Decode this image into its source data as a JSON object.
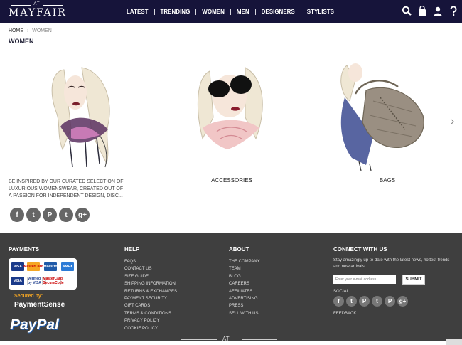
{
  "header": {
    "logo_at": "AT",
    "logo_name": "MAYFAIR",
    "nav": [
      "LATEST",
      "TRENDING",
      "WOMEN",
      "MEN",
      "DESIGNERS",
      "STYLISTS"
    ],
    "icons": [
      "search-icon",
      "bag-icon",
      "user-icon",
      "help-icon"
    ],
    "background": "#16143a"
  },
  "breadcrumb": {
    "home": "HOME",
    "current": "WOMEN"
  },
  "page_title": "WOMEN",
  "categories": [
    {
      "label": "ACCESSORIES",
      "image": "sketch of woman in sunglasses and pink scarf"
    },
    {
      "label": "BAGS",
      "image": "sketch of woman carrying grey leather handbag"
    }
  ],
  "hero_image": "sketch of woman with printed scarf",
  "intro_text": "BE INSPIRED BY OUR CURATED SELECTION OF LUXURIOUS WOMENSWEAR, CREATED OUT OF A PASSION FOR INDEPENDENT DESIGN, DISC...",
  "share_icons": [
    "facebook-icon",
    "twitter-icon",
    "pinterest-icon",
    "tumblr-icon",
    "googleplus-icon"
  ],
  "share_glyphs": [
    "f",
    "t",
    "P",
    "t",
    "g+"
  ],
  "footer": {
    "payments": {
      "heading": "PAYMENTS",
      "cards": [
        "VISA",
        "MasterCard",
        "Maestro",
        "AMEX",
        "VISA",
        "Verified by VISA",
        "MasterCard SecureCode"
      ],
      "secured_by": "Secured by:",
      "paymentsense": "PaymentSense",
      "paypal": "PayPal"
    },
    "help": {
      "heading": "HELP",
      "links": [
        "FAQS",
        "CONTACT US",
        "SIZE GUIDE",
        "SHIPPING INFORMATION",
        "RETURNS & EXCHANGES",
        "PAYMENT SECURITY",
        "GIFT CARDS",
        "TERMS & CONDITIONS",
        "PRIVACY POLICY",
        "COOKIE POLICY"
      ]
    },
    "about": {
      "heading": "ABOUT",
      "links": [
        "THE COMPANY",
        "TEAM",
        "BLOG",
        "CAREERS",
        "AFFILIATES",
        "ADVERTISING",
        "PRESS",
        "SELL WITH US"
      ]
    },
    "connect": {
      "heading": "CONNECT WITH US",
      "text": "Stay amazingly up-to-date with the latest news, hottest trends and new arrivals.",
      "email_placeholder": "Enter your e-mail address",
      "submit": "SUBMIT",
      "social_label": "SOCIAL",
      "social_icons": [
        "facebook-icon",
        "twitter-icon",
        "pinterest-icon",
        "tumblr-icon",
        "pinterest-p-icon",
        "googleplus-icon"
      ],
      "social_glyphs": [
        "f",
        "t",
        "P",
        "t",
        "P",
        "g+"
      ],
      "feedback": "FEEDBACK"
    },
    "logo_at": "AT",
    "background": "#3f3f3f"
  }
}
